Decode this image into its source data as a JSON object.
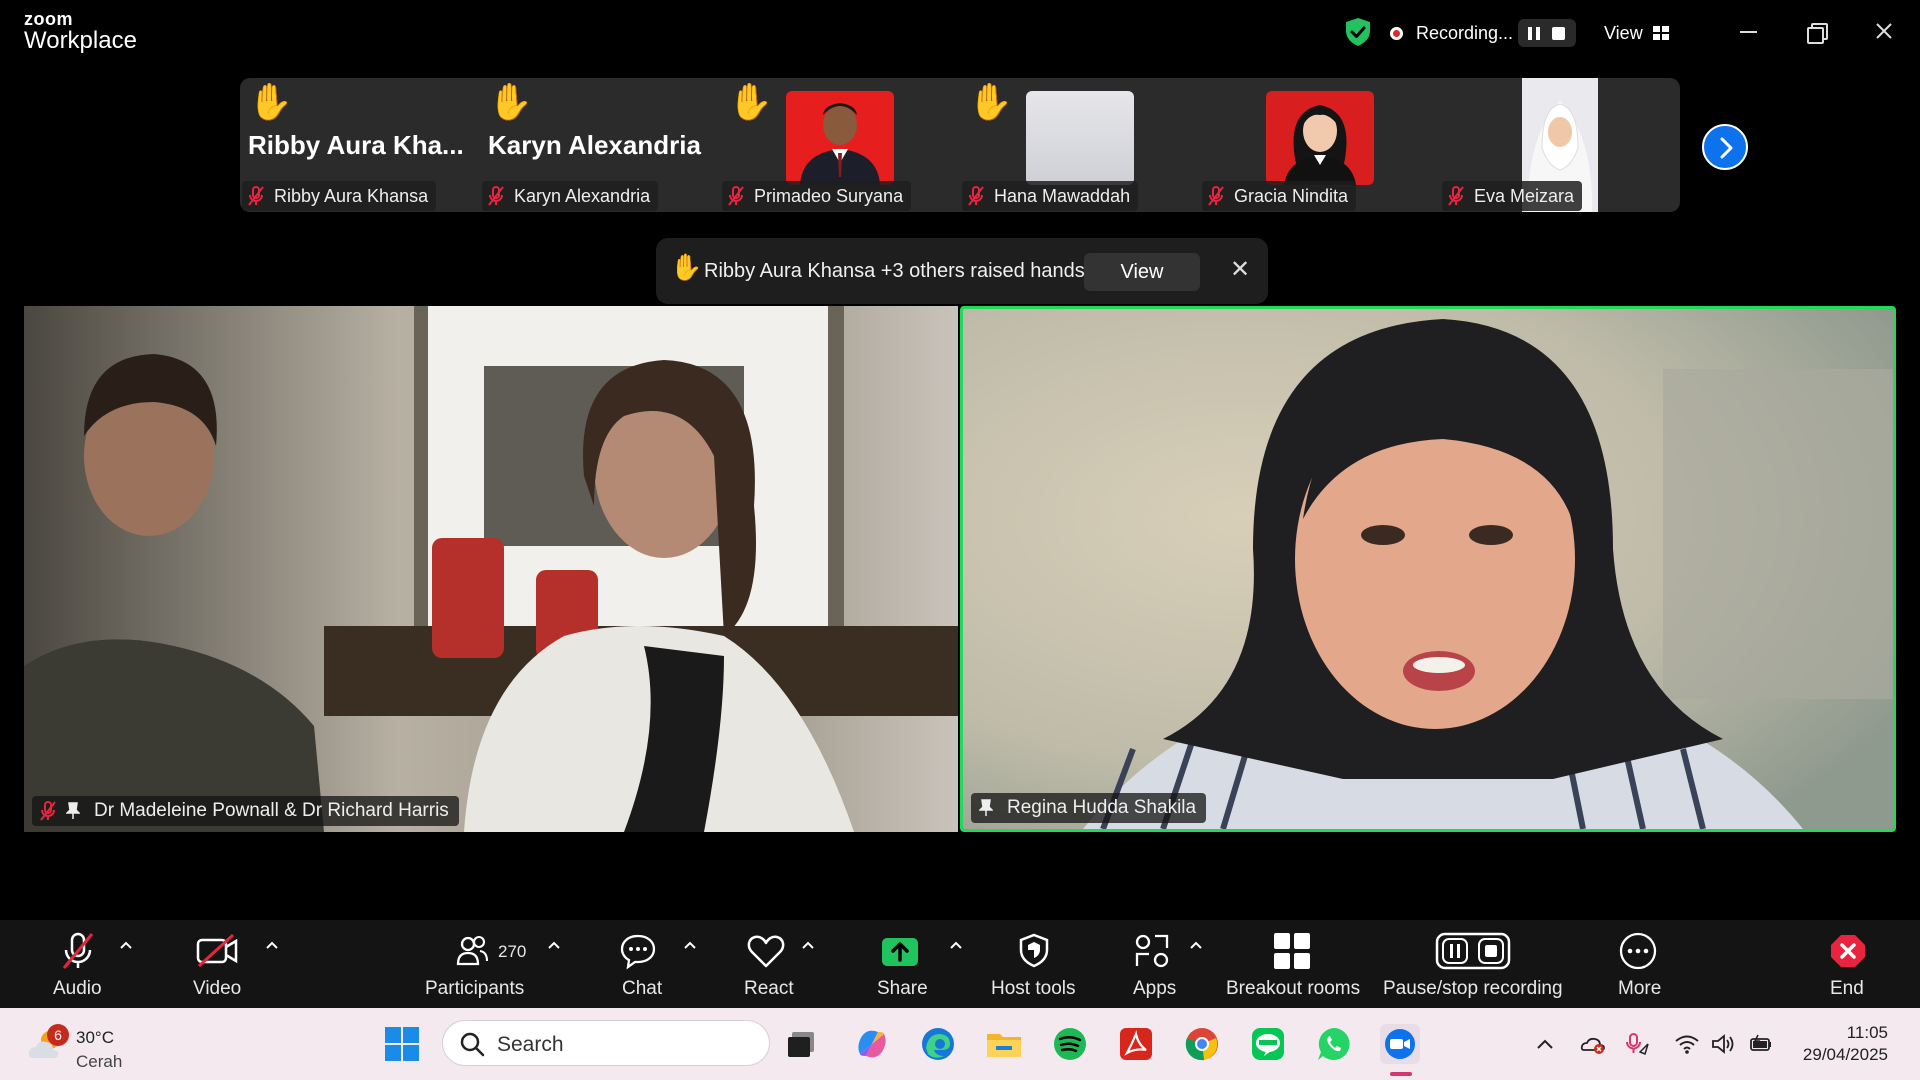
{
  "app": {
    "brand_top": "zoom",
    "brand_bottom": "Workplace",
    "recording_label": "Recording...",
    "view_label": "View"
  },
  "participants_strip": [
    {
      "big_name": "Ribby  Aura  Kha...",
      "tag": "Ribby Aura Khansa",
      "hand_raised": true
    },
    {
      "big_name": "Karyn Alexandria",
      "tag": "Karyn Alexandria",
      "hand_raised": true
    },
    {
      "big_name": "",
      "tag": "Primadeo Suryana",
      "hand_raised": true
    },
    {
      "big_name": "",
      "tag": "Hana Mawaddah",
      "hand_raised": true
    },
    {
      "big_name": "",
      "tag": "Gracia Nindita",
      "hand_raised": false
    },
    {
      "big_name": "",
      "tag": "Eva Meizara",
      "hand_raised": false
    }
  ],
  "notification": {
    "text": "Ribby Aura Khansa +3 others raised hands",
    "view_label": "View",
    "close_glyph": "✕"
  },
  "videos": [
    {
      "name": "Dr Madeleine Pownall & Dr Richard Harris",
      "muted": true,
      "pinned": true,
      "active_speaker": false
    },
    {
      "name": "Regina Hudda Shakila",
      "muted": false,
      "pinned": true,
      "active_speaker": true
    }
  ],
  "toolbar": {
    "audio": "Audio",
    "video": "Video",
    "participants": "Participants",
    "participants_count": "270",
    "chat": "Chat",
    "react": "React",
    "share": "Share",
    "host_tools": "Host tools",
    "apps": "Apps",
    "breakout_rooms": "Breakout rooms",
    "pause_stop_recording": "Pause/stop recording",
    "more": "More",
    "end": "End"
  },
  "taskbar": {
    "weather_badge": "6",
    "temperature": "30°C",
    "condition": "Cerah",
    "search_placeholder": "Search",
    "time": "11:05",
    "date": "29/04/2025"
  },
  "colors": {
    "accent_blue": "#0e72ed",
    "active_speaker": "#23d959",
    "recording_red": "#e02828",
    "end_red": "#e8243e",
    "share_green": "#20c35d"
  }
}
